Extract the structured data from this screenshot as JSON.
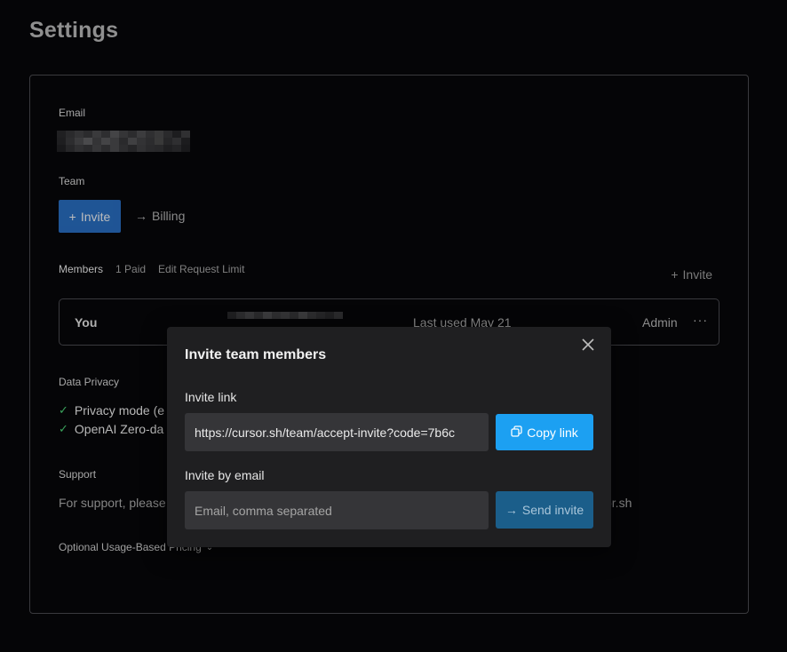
{
  "page": {
    "title": "Settings"
  },
  "settings": {
    "email_label": "Email",
    "team_label": "Team",
    "invite_button": "Invite",
    "billing_link": "Billing",
    "members_label": "Members",
    "paid_count": "1 Paid",
    "edit_limit": "Edit Request Limit",
    "invite_right": "Invite",
    "member": {
      "name": "You",
      "last_used": "Last used May 21",
      "role": "Admin",
      "more": "···"
    },
    "privacy_label": "Data Privacy",
    "privacy_items": [
      "Privacy mode (e",
      "OpenAI Zero-da"
    ],
    "support_label": "Support",
    "support_text": "For support, please",
    "support_tail": "sor.sh",
    "usage_pricing": "Optional Usage-Based Pricing"
  },
  "modal": {
    "title": "Invite team members",
    "invite_link_label": "Invite link",
    "invite_link_value": "https://cursor.sh/team/accept-invite?code=7b6c",
    "copy_button": "Copy link",
    "email_label": "Invite by email",
    "email_placeholder": "Email, comma separated",
    "send_button": "Send invite"
  },
  "colors": {
    "accent": "#1ca0f2",
    "invite_button": "#2463ae",
    "check": "#3aa35c"
  },
  "icons": [
    "plus-icon",
    "arrow-right-icon",
    "close-icon",
    "copy-icon",
    "check-icon",
    "chevron-down-icon"
  ]
}
